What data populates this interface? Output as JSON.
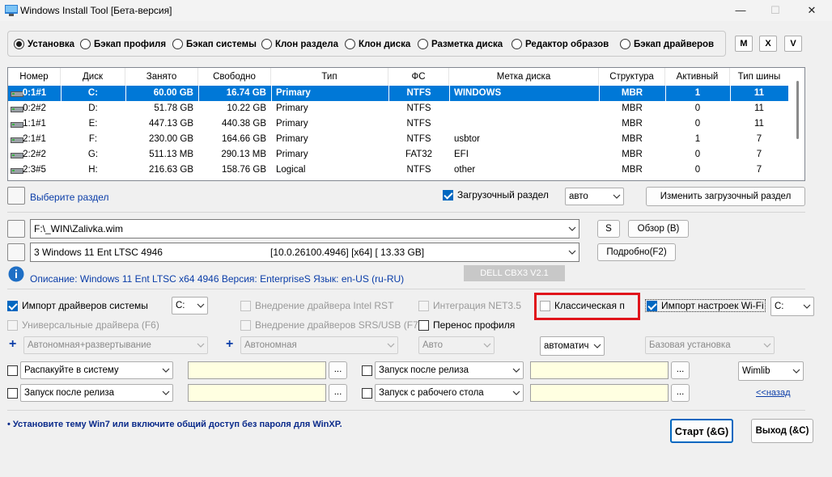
{
  "window": {
    "title": "Windows Install Tool [Бета-версия]",
    "minimize": "—",
    "maximize": "☐",
    "close": "✕"
  },
  "modes": [
    {
      "label": "Установка",
      "selected": true
    },
    {
      "label": "Бэкап профиля",
      "selected": false
    },
    {
      "label": "Бэкап системы",
      "selected": false
    },
    {
      "label": "Клон раздела",
      "selected": false
    },
    {
      "label": "Клон диска",
      "selected": false
    },
    {
      "label": "Разметка диска",
      "selected": false
    },
    {
      "label": "Редактор образов",
      "selected": false
    },
    {
      "label": "Бэкап драйверов",
      "selected": false
    }
  ],
  "quick_buttons": {
    "m": "M",
    "x": "X",
    "v": "V"
  },
  "table": {
    "columns": [
      "Номер",
      "Диск",
      "Занято",
      "Свободно",
      "Тип",
      "ФС",
      "Метка диска",
      "Структура",
      "Активный",
      "Тип шины"
    ],
    "rows": [
      [
        "0:1#1",
        "C:",
        "60.00 GB",
        "16.74 GB",
        "Primary",
        "NTFS",
        "WINDOWS",
        "MBR",
        "1",
        "11"
      ],
      [
        "0:2#2",
        "D:",
        "51.78 GB",
        "10.22 GB",
        "Primary",
        "NTFS",
        "",
        "MBR",
        "0",
        "11"
      ],
      [
        "1:1#1",
        "E:",
        "447.13 GB",
        "440.38 GB",
        "Primary",
        "NTFS",
        "",
        "MBR",
        "0",
        "11"
      ],
      [
        "2:1#1",
        "F:",
        "230.00 GB",
        "164.66 GB",
        "Primary",
        "NTFS",
        "usbtor",
        "MBR",
        "1",
        "7"
      ],
      [
        "2:2#2",
        "G:",
        "511.13 MB",
        "290.13 MB",
        "Primary",
        "FAT32",
        "EFI",
        "MBR",
        "0",
        "7"
      ],
      [
        "2:3#5",
        "H:",
        "216.63 GB",
        "158.76 GB",
        "Logical",
        "NTFS",
        "other",
        "MBR",
        "0",
        "7"
      ]
    ],
    "selected_row": 0
  },
  "partition": {
    "select_label": "Выберите раздел",
    "boot_checkbox": "Загрузочный раздел",
    "boot_checked": true,
    "boot_mode": "авто",
    "change_boot_button": "Изменить загрузочный раздел"
  },
  "image": {
    "path": "F:\\_WIN\\Zalivka.wim",
    "s_button": "S",
    "browse_button": "Обзор (B)",
    "edition": "3  Windows 11 Ent LTSC 4946",
    "edition_info": "[10.0.26100.4946] [x64] [ 13.33 GB]",
    "details_button": "Подробно(F2)",
    "description": "Описание: Windows 11 Ent LTSC x64 4946 Версия: EnterpriseS Язык: en-US (ru-RU)",
    "model_badge": "DELL CBX3 V2.1"
  },
  "options": {
    "import_drivers": "Импорт драйверов системы",
    "import_drivers_drive": "C:",
    "intel_rst": "Внедрение драйвера Intel RST",
    "net35": "Интеграция NET3.5",
    "classic": "Классическая п",
    "wifi": "Импорт настроек Wi-Fi",
    "wifi_drive": "C:",
    "universal_drivers": "Универсальные драйвера (F6)",
    "srs_drivers": "Внедрение драйверов SRS/USB (F7)",
    "profile_move": "Перенос профиля",
    "autonomous_deploy": "Автономная+развертывание",
    "autonomous": "Автономная",
    "auto": "Авто",
    "automatic": "автоматич",
    "basic_install": "Базовая установка"
  },
  "actions": {
    "unpack": "Распакуйте в систему",
    "after_release_1": "Запуск после релиза",
    "after_release_2": "Запуск после релиза",
    "from_desktop": "Запуск с рабочего стола",
    "dots": "...",
    "lib": "Wimlib",
    "back_link": "<<назад"
  },
  "footer": {
    "hint": "• Установите тему  Win7 или включите общий доступ без пароля для WinXP.",
    "start_button": "Старт (&G)",
    "exit_button": "Выход (&C)"
  },
  "colors": {
    "selection": "#0078d7",
    "highlight_box": "#e0141b",
    "link": "#0a3da8"
  }
}
